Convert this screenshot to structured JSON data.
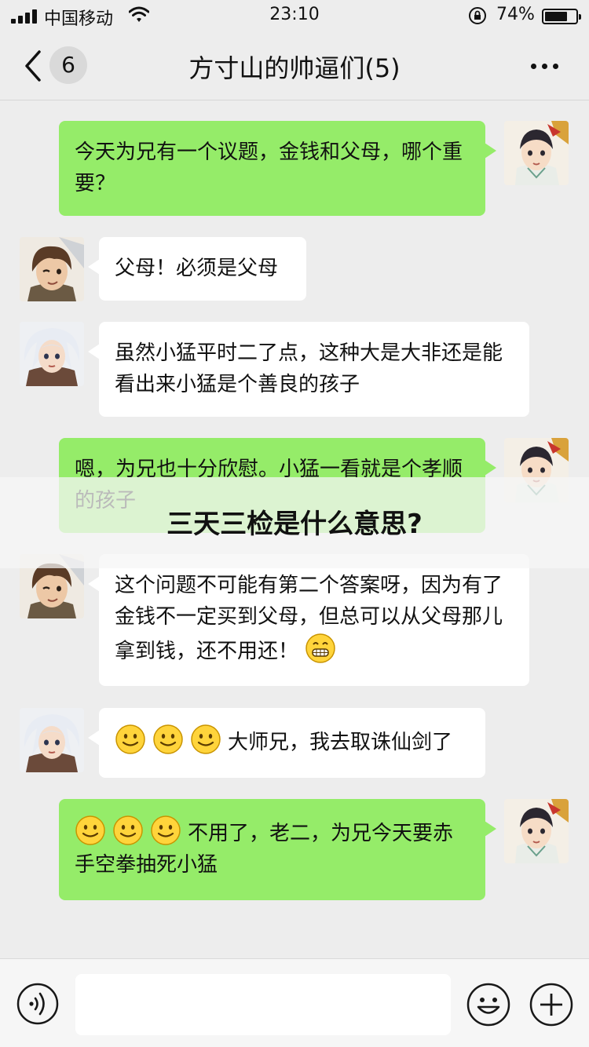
{
  "status_bar": {
    "carrier": "中国移动",
    "time": "23:10",
    "battery_percent_label": "74%",
    "battery_level": 0.74
  },
  "nav": {
    "unread_count": "6",
    "title": "方寸山的帅逼们(5)"
  },
  "messages": [
    {
      "side": "me",
      "avatar": "young-hero-avatar",
      "text": "今天为兄有一个议题，金钱和父母，哪个重要？"
    },
    {
      "side": "other",
      "avatar": "brown-hair-warrior-avatar",
      "text": "父母！必须是父母"
    },
    {
      "side": "other",
      "avatar": "white-hair-swordsman-avatar",
      "text": "虽然小猛平时二了点，这种大是大非还是能看出来小猛是个善良的孩子"
    },
    {
      "side": "me",
      "avatar": "young-hero-avatar",
      "text": "嗯，为兄也十分欣慰。小猛一看就是个孝顺的孩子"
    },
    {
      "side": "other",
      "avatar": "brown-hair-warrior-avatar",
      "text": "这个问题不可能有第二个答案呀，因为有了金钱不一定买到父母，但总可以从父母那儿拿到钱，还不用还！",
      "emoji_after": "grin-emoji"
    },
    {
      "side": "other",
      "avatar": "white-hair-swordsman-avatar",
      "emoji_before": [
        "smile-emoji",
        "smile-emoji",
        "smile-emoji"
      ],
      "text": "大师兄，我去取诛仙剑了"
    },
    {
      "side": "me",
      "avatar": "young-hero-avatar",
      "emoji_before": [
        "smile-emoji",
        "smile-emoji",
        "smile-emoji"
      ],
      "text": "不用了，老二，为兄今天要赤手空拳抽死小猛"
    }
  ],
  "overlay": {
    "title": "三天三检是什么意思?"
  },
  "input_bar": {
    "voice_icon": "voice-icon",
    "emoji_icon": "emoji-icon",
    "plus_icon": "plus-icon",
    "text_value": ""
  },
  "colors": {
    "background": "#ededed",
    "my_bubble": "#95ec69",
    "other_bubble": "#ffffff"
  }
}
